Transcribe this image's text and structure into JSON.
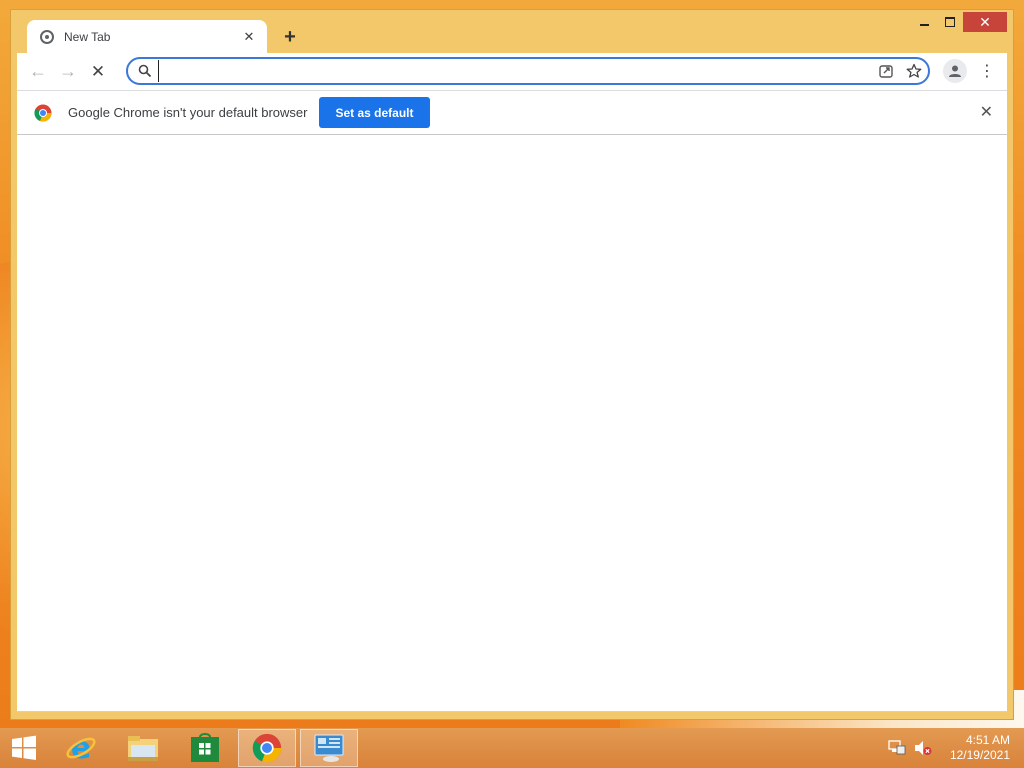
{
  "tab": {
    "title": "New Tab",
    "close_glyph": "✕"
  },
  "new_tab": {
    "glyph": "+"
  },
  "window_controls": {
    "close_glyph": "✕"
  },
  "toolbar": {
    "back_glyph": "←",
    "forward_glyph": "→",
    "stop_glyph": "✕",
    "menu_glyph": "⋮"
  },
  "omnibox": {
    "value": "",
    "placeholder": ""
  },
  "infobar": {
    "message": "Google Chrome isn't your default browser",
    "button_label": "Set as default",
    "close_glyph": "✕"
  },
  "taskbar": {
    "apps": [
      {
        "name": "internet-explorer",
        "active": false
      },
      {
        "name": "file-explorer",
        "active": false
      },
      {
        "name": "store",
        "active": false
      },
      {
        "name": "chrome",
        "active": true
      },
      {
        "name": "control-panel",
        "active": false
      }
    ],
    "clock": {
      "time": "4:51 AM",
      "date": "12/19/2021"
    }
  },
  "colors": {
    "window_frame": "#f3c86a",
    "accent_blue": "#1a73e8",
    "close_red": "#c7443a",
    "taskbar": "#d9823a"
  }
}
